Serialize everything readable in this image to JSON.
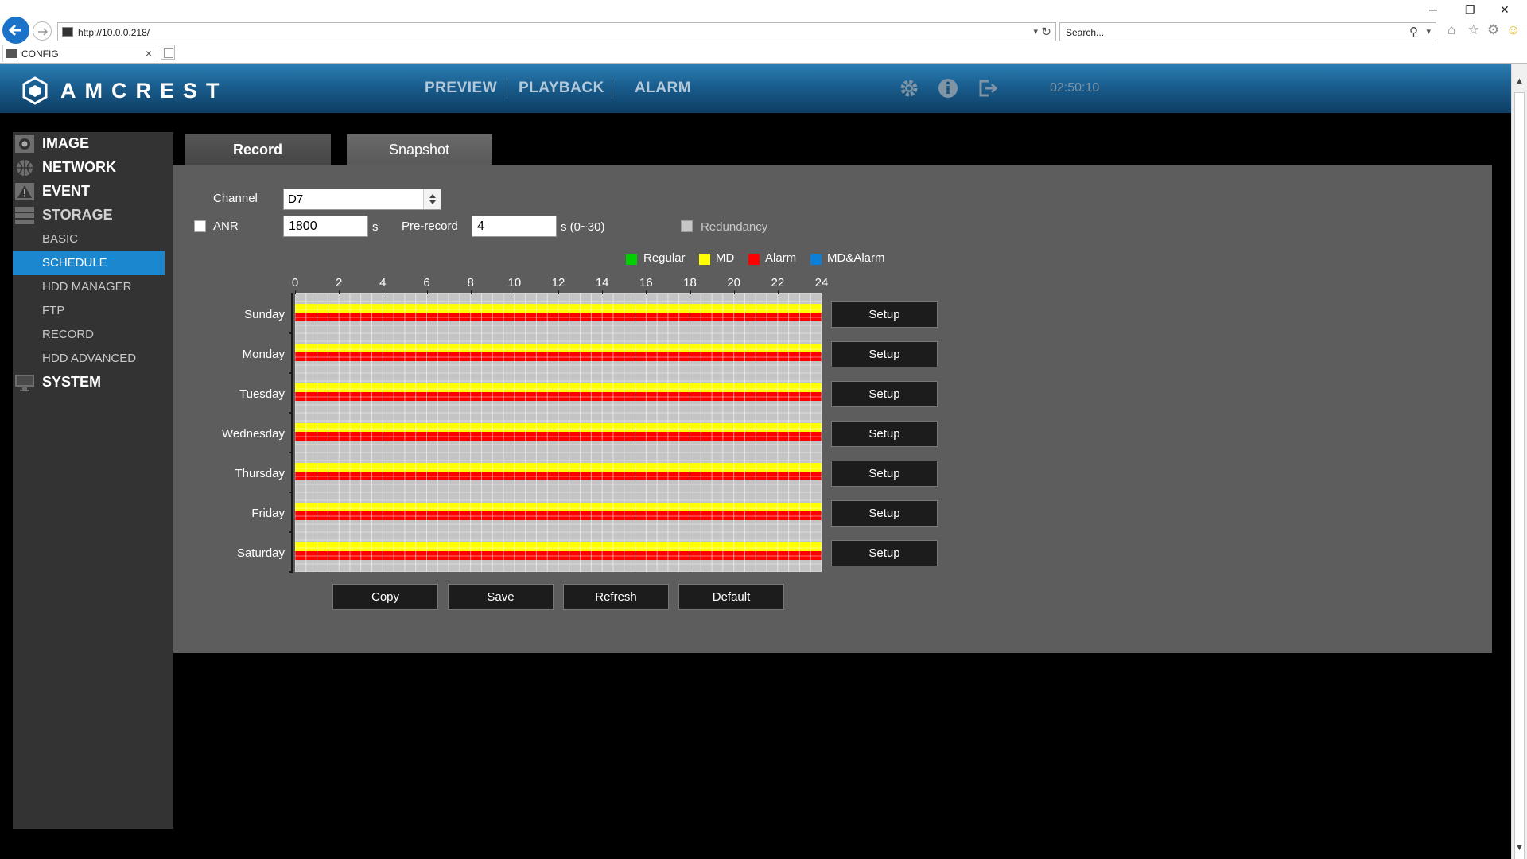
{
  "browser": {
    "url": "http://10.0.0.218/",
    "search_placeholder": "Search...",
    "tab_title": "CONFIG",
    "tab_close": "×",
    "win_min": "─",
    "win_restore": "❐",
    "win_close": "✕"
  },
  "header": {
    "brand": "AMCREST",
    "nav": [
      "PREVIEW",
      "PLAYBACK",
      "ALARM"
    ],
    "clock": "02:50:10"
  },
  "sidebar": {
    "items": [
      {
        "label": "IMAGE",
        "type": "main",
        "icon": "camera-icon"
      },
      {
        "label": "NETWORK",
        "type": "main",
        "icon": "network-icon"
      },
      {
        "label": "EVENT",
        "type": "main",
        "icon": "warning-icon"
      },
      {
        "label": "STORAGE",
        "type": "main",
        "icon": "storage-icon"
      },
      {
        "label": "BASIC",
        "type": "sub"
      },
      {
        "label": "SCHEDULE",
        "type": "sub",
        "active": true
      },
      {
        "label": "HDD MANAGER",
        "type": "sub"
      },
      {
        "label": "FTP",
        "type": "sub"
      },
      {
        "label": "RECORD",
        "type": "sub"
      },
      {
        "label": "HDD ADVANCED",
        "type": "sub"
      },
      {
        "label": "SYSTEM",
        "type": "main",
        "icon": "monitor-icon"
      }
    ]
  },
  "tabs": {
    "record": "Record",
    "snapshot": "Snapshot"
  },
  "form": {
    "channel_label": "Channel",
    "channel_value": "D7",
    "anr_label": "ANR",
    "anr_value": "1800",
    "anr_unit": "s",
    "prerecord_label": "Pre-record",
    "prerecord_value": "4",
    "prerecord_unit": "s (0~30)",
    "redundancy_label": "Redundancy"
  },
  "legend": [
    {
      "label": "Regular",
      "color": "#00d000"
    },
    {
      "label": "MD",
      "color": "#ffff00"
    },
    {
      "label": "Alarm",
      "color": "#ff0000"
    },
    {
      "label": "MD&Alarm",
      "color": "#0e7fd6"
    }
  ],
  "schedule": {
    "hour_ticks": [
      "0",
      "2",
      "4",
      "6",
      "8",
      "10",
      "12",
      "14",
      "16",
      "18",
      "20",
      "22",
      "24"
    ],
    "days": [
      "Sunday",
      "Monday",
      "Tuesday",
      "Wednesday",
      "Thursday",
      "Friday",
      "Saturday"
    ],
    "setup_label": "Setup",
    "md_hours": [
      0,
      24
    ],
    "alarm_hours": [
      0,
      24
    ]
  },
  "actions": {
    "copy": "Copy",
    "save": "Save",
    "refresh": "Refresh",
    "default": "Default"
  }
}
